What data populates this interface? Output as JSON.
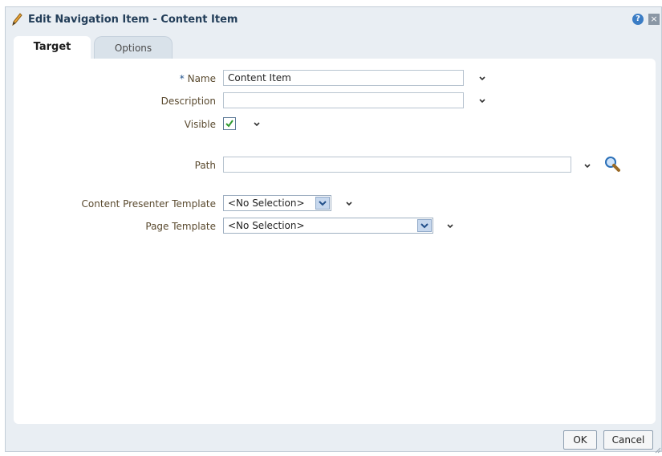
{
  "dialog": {
    "title": "Edit Navigation Item - Content Item",
    "help_icon_glyph": "?",
    "close_icon_glyph": "×"
  },
  "tabs": [
    {
      "label": "Target",
      "selected": true
    },
    {
      "label": "Options",
      "selected": false
    }
  ],
  "form": {
    "name": {
      "required_marker": "*",
      "label": "Name",
      "value": "Content Item"
    },
    "description": {
      "label": "Description",
      "value": ""
    },
    "visible": {
      "label": "Visible",
      "checked": true
    },
    "path": {
      "label": "Path",
      "value": ""
    },
    "content_presenter_template": {
      "label": "Content Presenter Template",
      "value": "<No Selection>"
    },
    "page_template": {
      "label": "Page Template",
      "value": "<No Selection>"
    }
  },
  "buttons": {
    "ok": "OK",
    "cancel": "Cancel"
  },
  "icons": {
    "edit": "pencil-icon",
    "help": "help-icon",
    "close": "close-icon",
    "chevron": "chevron-down-icon",
    "search": "magnifier-icon"
  },
  "colors": {
    "title_text": "#233e59",
    "label_text": "#5a4a2f",
    "panel_bg": "#e9eef3",
    "checkmark": "#2f9a2f"
  }
}
